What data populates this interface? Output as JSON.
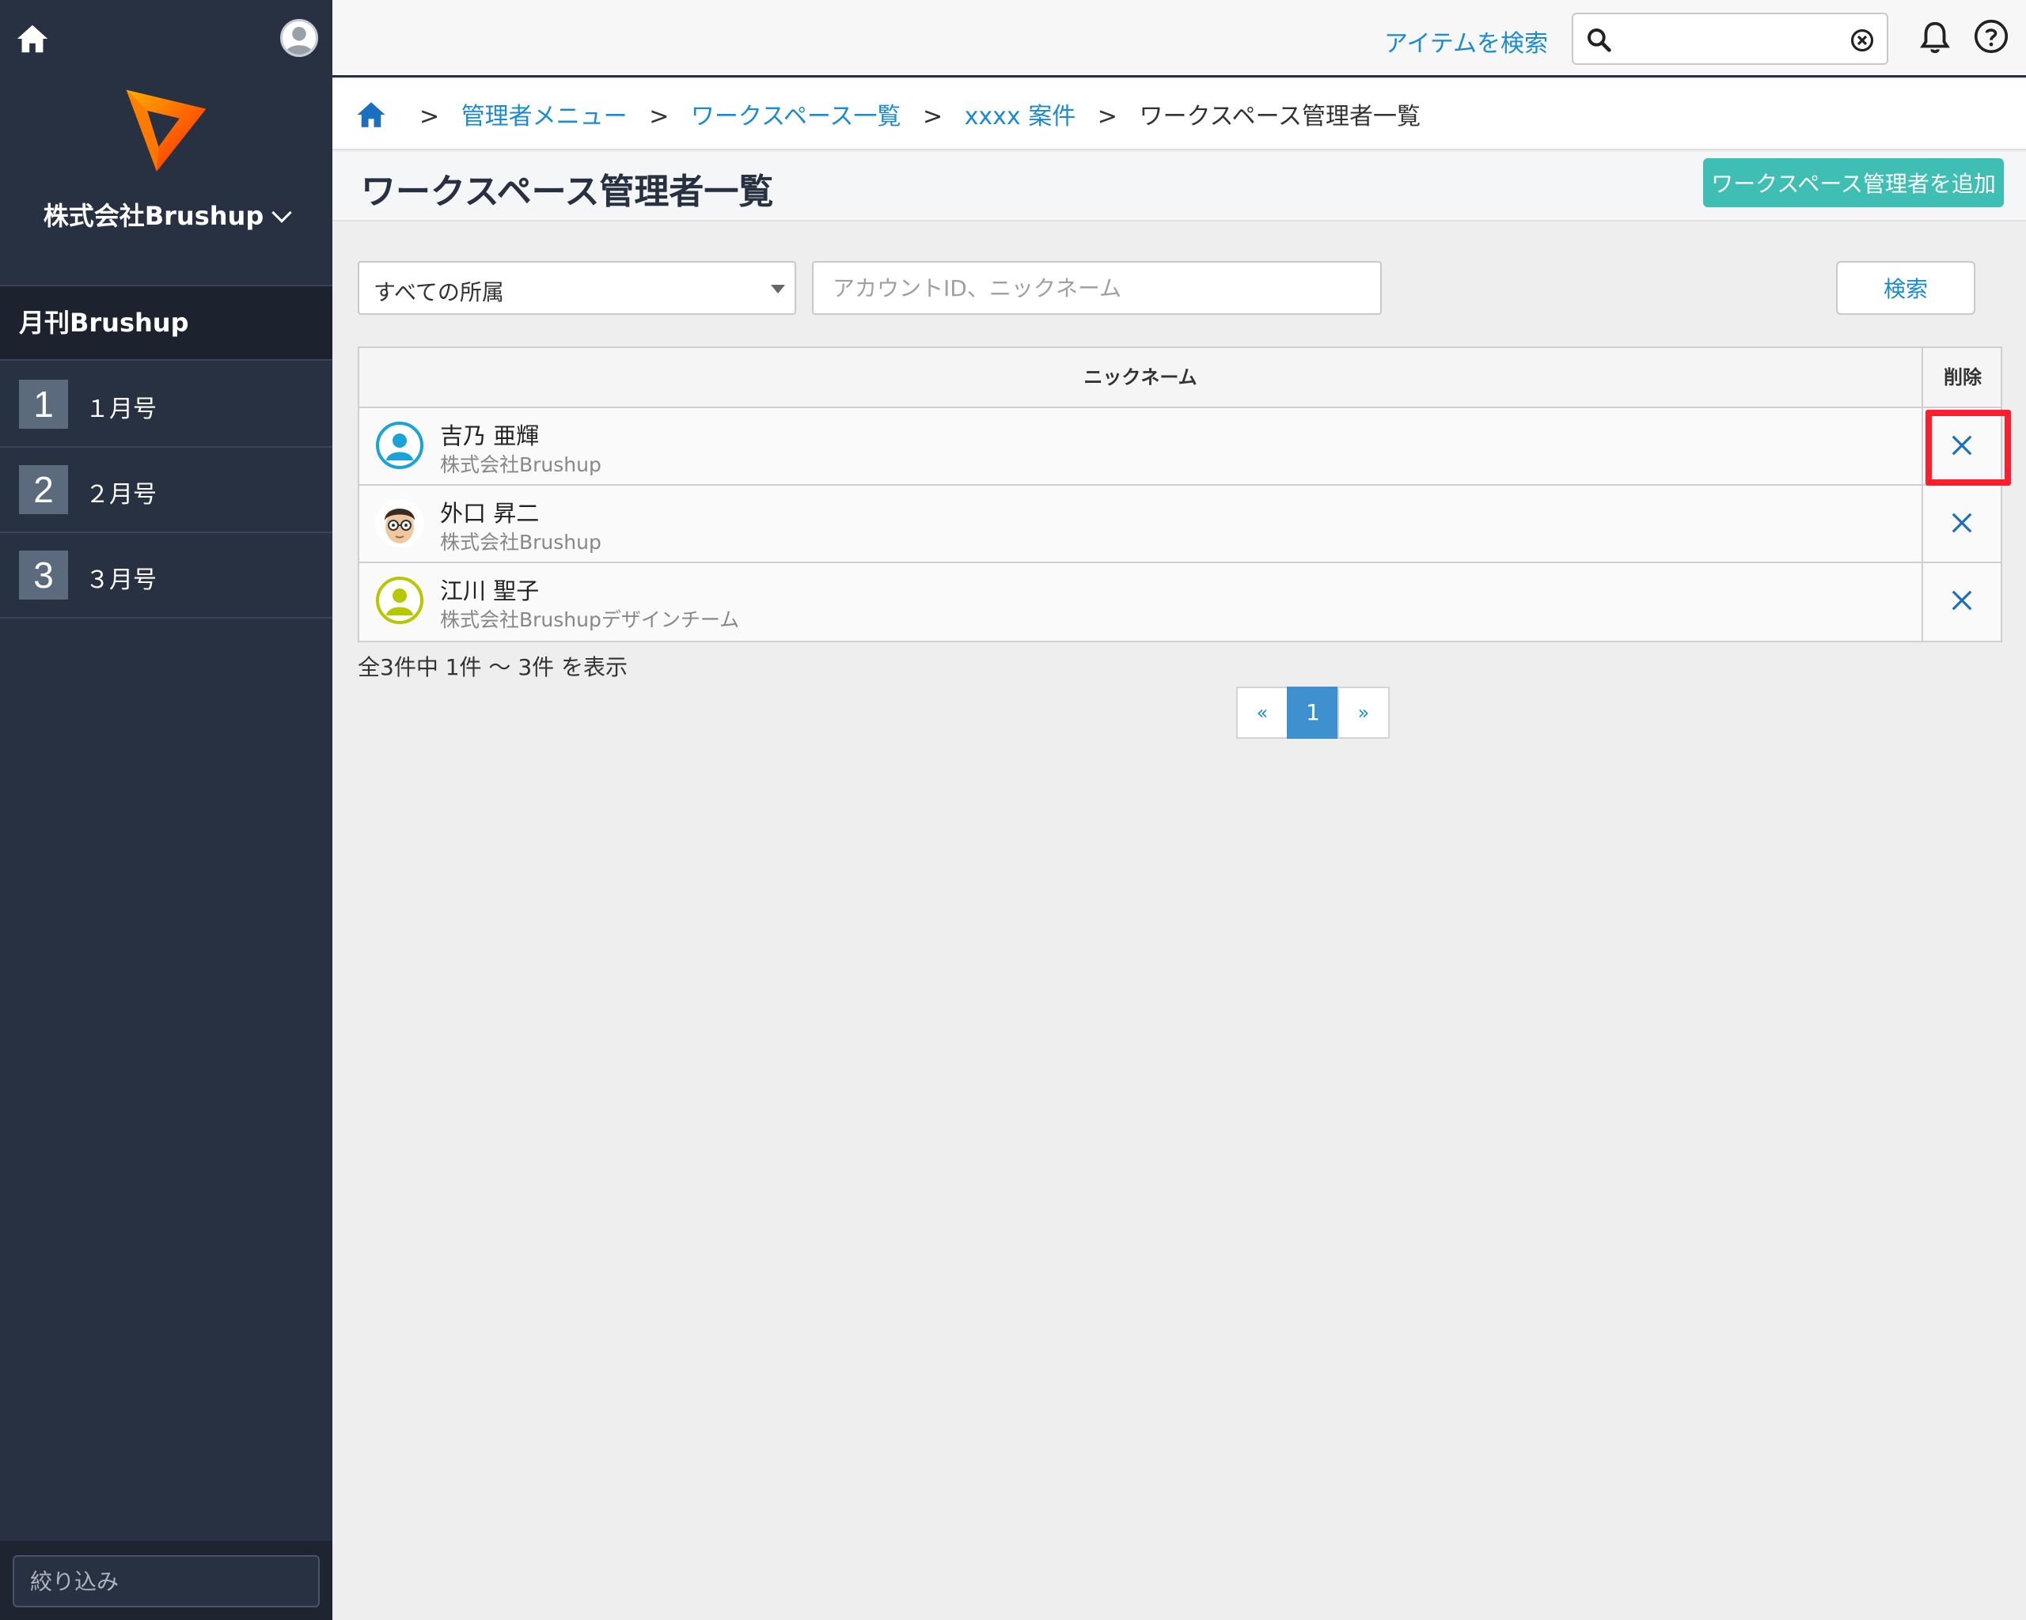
{
  "sidebar": {
    "company_name": "株式会社Brushup",
    "section_title": "月刊Brushup",
    "items": [
      {
        "number": "1",
        "label": "１月号"
      },
      {
        "number": "2",
        "label": "２月号"
      },
      {
        "number": "3",
        "label": "３月号"
      }
    ],
    "filter_placeholder": "絞り込み"
  },
  "header": {
    "search_link": "アイテムを検索",
    "search_value": ""
  },
  "breadcrumb": {
    "separator": ">",
    "items": [
      "管理者メニュー",
      "ワークスペース一覧",
      "xxxx 案件"
    ],
    "current": "ワークスペース管理者一覧"
  },
  "page": {
    "title": "ワークスペース管理者一覧",
    "add_button": "ワークスペース管理者を追加"
  },
  "filters": {
    "affiliation_selected": "すべての所属",
    "keyword_placeholder": "アカウントID、ニックネーム",
    "search_button": "検索"
  },
  "table": {
    "columns": [
      "ニックネーム",
      "削除"
    ],
    "rows": [
      {
        "name": "吉乃 亜輝",
        "org": "株式会社Brushup",
        "avatar": "default-user-icon",
        "avatar_color": "#1aa3d6"
      },
      {
        "name": "外口 昇二",
        "org": "株式会社Brushup",
        "avatar": "glasses-face-avatar",
        "avatar_color": "#f0c8a0"
      },
      {
        "name": "江川 聖子",
        "org": "株式会社Brushupデザインチーム",
        "avatar": "default-user-icon",
        "avatar_color": "#b5c800"
      }
    ]
  },
  "pagination": {
    "summary": "全3件中 1件 〜 3件 を表示",
    "prev": "«",
    "current": "1",
    "next": "»"
  },
  "colors": {
    "accent": "#1a8bd0",
    "sidebar_bg": "#283142",
    "add_button": "#3fbfb3",
    "highlight": "#ff1e2e"
  }
}
